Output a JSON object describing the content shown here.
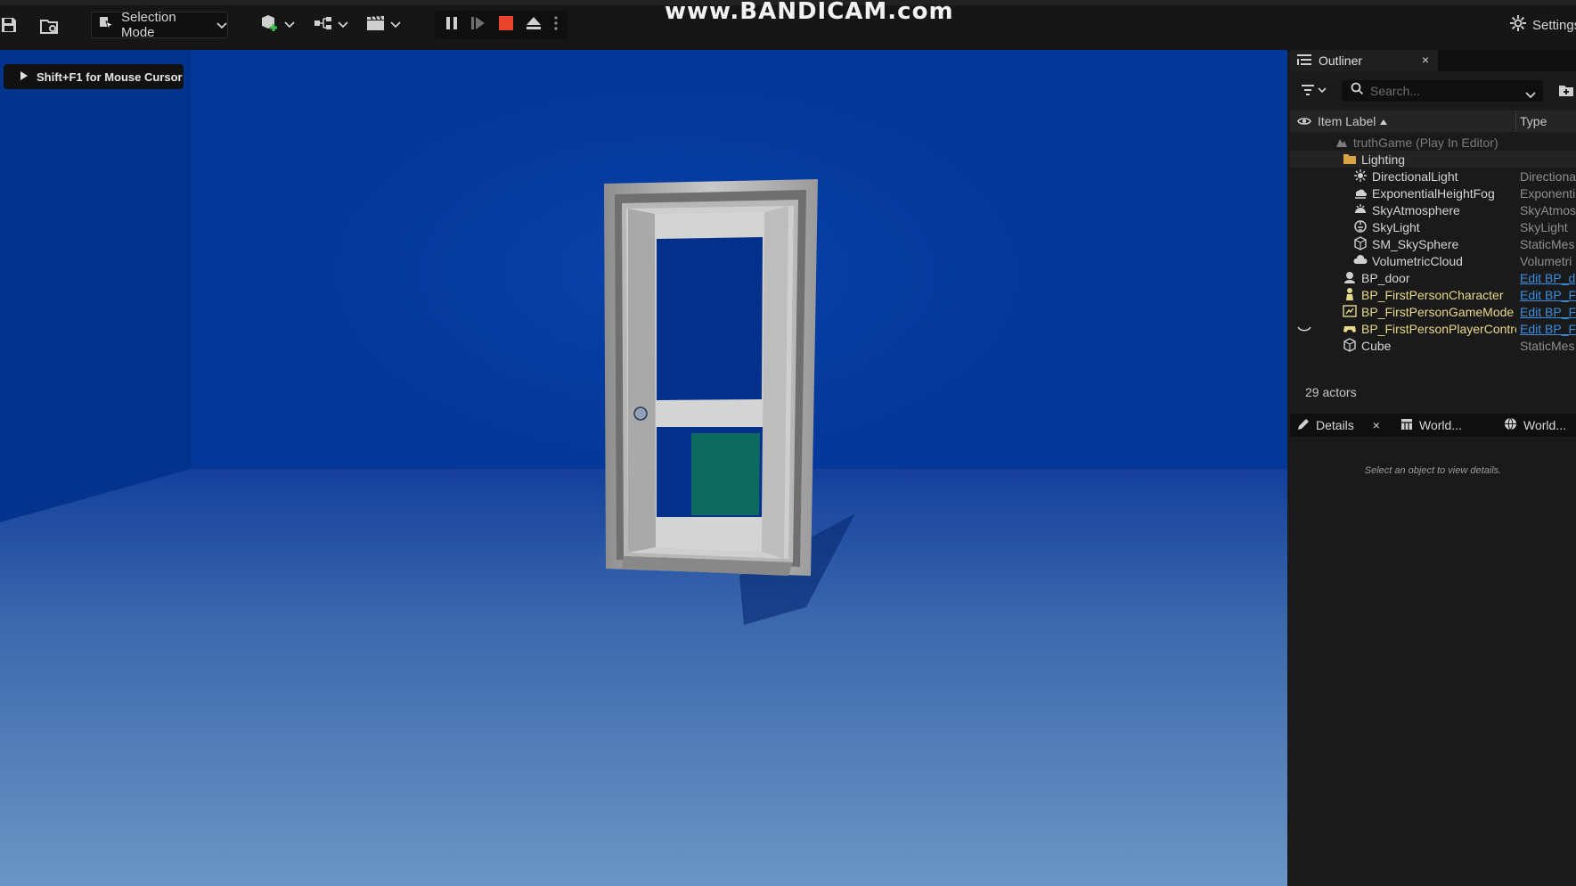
{
  "watermark": "www.BANDICAM.com",
  "toolbar": {
    "selection_mode_label": "Selection Mode",
    "settings_label": "Settings",
    "icons": [
      "save-icon",
      "content-browser-icon",
      "add-actor-icon",
      "blueprint-icon",
      "cinematics-icon",
      "pause-icon",
      "skip-frame-icon",
      "stop-icon",
      "eject-icon",
      "more-options-icon",
      "gear-icon"
    ]
  },
  "viewport": {
    "hint_text": "Shift+F1 for Mouse Cursor"
  },
  "outliner": {
    "tab_label": "Outliner",
    "close_glyph": "×",
    "search_placeholder": "Search...",
    "columns": {
      "item_label": "Item Label",
      "type": "Type"
    },
    "rows": [
      {
        "label": "truthGame (Play In Editor)",
        "type": "",
        "icon": "world-icon",
        "indent": 1,
        "dim": true
      },
      {
        "label": "Lighting",
        "type": "",
        "icon": "folder-icon",
        "indent": 2,
        "folder": true
      },
      {
        "label": "DirectionalLight",
        "type": "Directiona",
        "icon": "sun-icon",
        "indent": 3
      },
      {
        "label": "ExponentialHeightFog",
        "type": "Exponenti",
        "icon": "fog-icon",
        "indent": 3
      },
      {
        "label": "SkyAtmosphere",
        "type": "SkyAtmos",
        "icon": "atmosphere-icon",
        "indent": 3
      },
      {
        "label": "SkyLight",
        "type": "SkyLight",
        "icon": "skylight-icon",
        "indent": 3
      },
      {
        "label": "SM_SkySphere",
        "type": "StaticMes",
        "icon": "static-mesh-icon",
        "indent": 3
      },
      {
        "label": "VolumetricCloud",
        "type": "Volumetri",
        "icon": "cloud-icon",
        "indent": 3
      },
      {
        "label": "BP_door",
        "type": "Edit BP_d",
        "icon": "actor-icon",
        "indent": 2,
        "link": true
      },
      {
        "label": "BP_FirstPersonCharacter",
        "type": "Edit BP_F",
        "icon": "character-icon",
        "indent": 2,
        "link": true,
        "highlight": true
      },
      {
        "label": "BP_FirstPersonGameMode",
        "type": "Edit BP_F",
        "icon": "gamemode-icon",
        "indent": 2,
        "link": true,
        "highlight": true
      },
      {
        "label": "BP_FirstPersonPlayerController",
        "type": "Edit BP_F",
        "icon": "controller-icon",
        "indent": 2,
        "link": true,
        "highlight": true,
        "hidden_eye": true
      },
      {
        "label": "Cube",
        "type": "StaticMes",
        "icon": "static-mesh-icon",
        "indent": 2
      }
    ],
    "actor_count": "29 actors"
  },
  "details": {
    "tabs": [
      {
        "label": "Details",
        "icon": "pencil-icon",
        "closable": true
      },
      {
        "label": "World...",
        "icon": "world-partition-icon"
      },
      {
        "label": "World...",
        "icon": "globe-icon"
      }
    ],
    "empty_text": "Select an object to view details."
  },
  "colors": {
    "viewport_sky": "#043898",
    "link": "#3a8fe2",
    "highlight_text": "#e6d98a",
    "stop_button": "#e8432c"
  }
}
